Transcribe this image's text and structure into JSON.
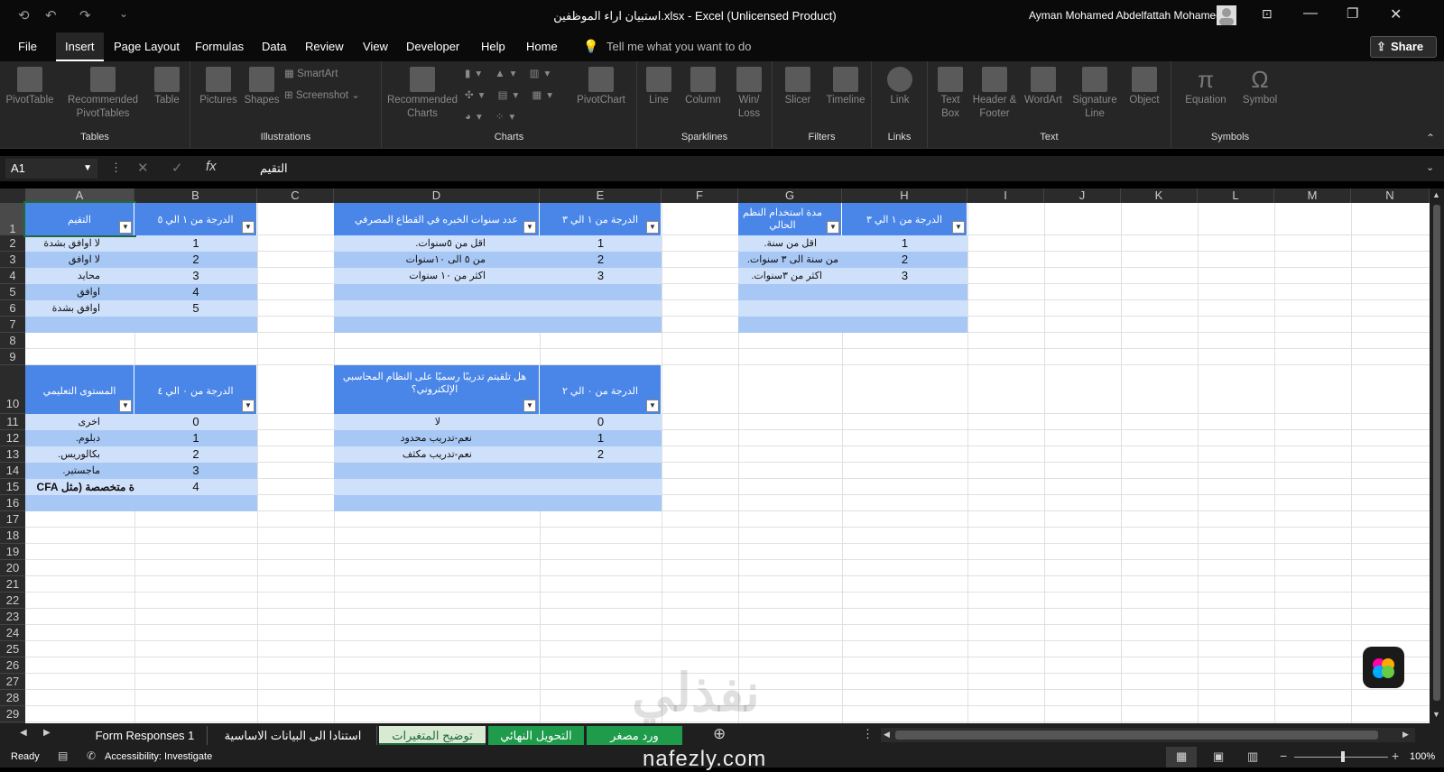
{
  "window": {
    "title": "استبيان اراء الموظفين.xlsx  -  Excel (Unlicensed Product)",
    "user": "Ayman Mohamed Abdelfattah Mohamed"
  },
  "menu": {
    "items": [
      "File",
      "Insert",
      "Page Layout",
      "Formulas",
      "Data",
      "Review",
      "View",
      "Developer",
      "Help",
      "Home"
    ],
    "tell_me": "Tell me what you want to do",
    "share": "Share"
  },
  "ribbon": {
    "tables": {
      "label": "Tables",
      "pivot": "PivotTable",
      "recommended": "Recommended PivotTables",
      "table": "Table"
    },
    "illustrations": {
      "label": "Illustrations",
      "pictures": "Pictures",
      "shapes": "Shapes",
      "smartart": "SmartArt",
      "screenshot": "Screenshot"
    },
    "charts": {
      "label": "Charts",
      "recommended": "Recommended Charts",
      "pivotchart": "PivotChart"
    },
    "sparklines": {
      "label": "Sparklines",
      "line": "Line",
      "column": "Column",
      "winloss": "Win/ Loss"
    },
    "filters": {
      "label": "Filters",
      "slicer": "Slicer",
      "timeline": "Timeline"
    },
    "links": {
      "label": "Links",
      "link": "Link"
    },
    "text": {
      "label": "Text",
      "textbox": "Text Box",
      "header": "Header & Footer",
      "wordart": "WordArt",
      "signature": "Signature Line",
      "object": "Object"
    },
    "symbols": {
      "label": "Symbols",
      "equation": "Equation",
      "symbol": "Symbol"
    }
  },
  "formula": {
    "namebox": "A1",
    "content": "التقيم"
  },
  "columns": [
    "A",
    "B",
    "C",
    "D",
    "E",
    "F",
    "G",
    "H",
    "I",
    "J",
    "K",
    "L",
    "M",
    "N"
  ],
  "rows": [
    "1",
    "2",
    "3",
    "4",
    "5",
    "6",
    "7",
    "8",
    "9",
    "10",
    "11",
    "12",
    "13",
    "14",
    "15",
    "16",
    "17",
    "18",
    "19",
    "20",
    "21",
    "22",
    "23",
    "24",
    "25",
    "26",
    "27",
    "28",
    "29",
    "30"
  ],
  "t1": {
    "h1": "التقيم",
    "h2": "الدرجة من ١ الي ٥",
    "labels": [
      "لا اوافق بشدة",
      "لا اوافق",
      "محايد",
      "اوافق",
      "اوافق بشدة"
    ],
    "vals": [
      "1",
      "2",
      "3",
      "4",
      "5"
    ]
  },
  "t2": {
    "h1": "عدد سنوات الخبره في القطاع المصرفي",
    "h2": "الدرجة من ١ الي ٣",
    "labels": [
      "اقل من ٥سنوات.",
      "من ٥ الى ١٠سنوات",
      "اكثر من ١٠ سنوات"
    ],
    "vals": [
      "1",
      "2",
      "3"
    ]
  },
  "t3": {
    "h1": "مدة استخدام النظم الحالي",
    "h2": "الدرجة من ١ الي ٣",
    "labels": [
      "اقل من سنة.",
      "من سنة الى ٣ سنوات.",
      "اكثر من ٣سنوات."
    ],
    "vals": [
      "1",
      "2",
      "3"
    ]
  },
  "t4": {
    "h1": "المستوى التعليمي",
    "h2": "الدرجة من ٠ الي ٤",
    "labels": [
      "اخرى",
      "دبلوم.",
      "بكالوريس.",
      "ماجستير.",
      "ة متخصصة (مثل CFA"
    ],
    "vals": [
      "0",
      "1",
      "2",
      "3",
      "4"
    ]
  },
  "t5": {
    "h1": "هل تلقيتم تدريبًا رسميًا على النظام المحاسبي الإلكتروني؟",
    "h2": "الدرجة من ٠ الي ٢",
    "labels": [
      "لا",
      "نعم-تدريب محدود",
      "نعم-تدريب مكثف"
    ],
    "vals": [
      "0",
      "1",
      "2"
    ]
  },
  "tabs": [
    "Form Responses 1",
    "استنادا الى البيانات الاساسية",
    "توضيح المتغيرات",
    "التحويل النهائي",
    "ورد مصغر"
  ],
  "status": {
    "ready": "Ready",
    "accessibility": "Accessibility: Investigate",
    "zoom": "100%"
  },
  "watermark": {
    "ar": "نفذلي",
    "en": "nafezly.com"
  }
}
